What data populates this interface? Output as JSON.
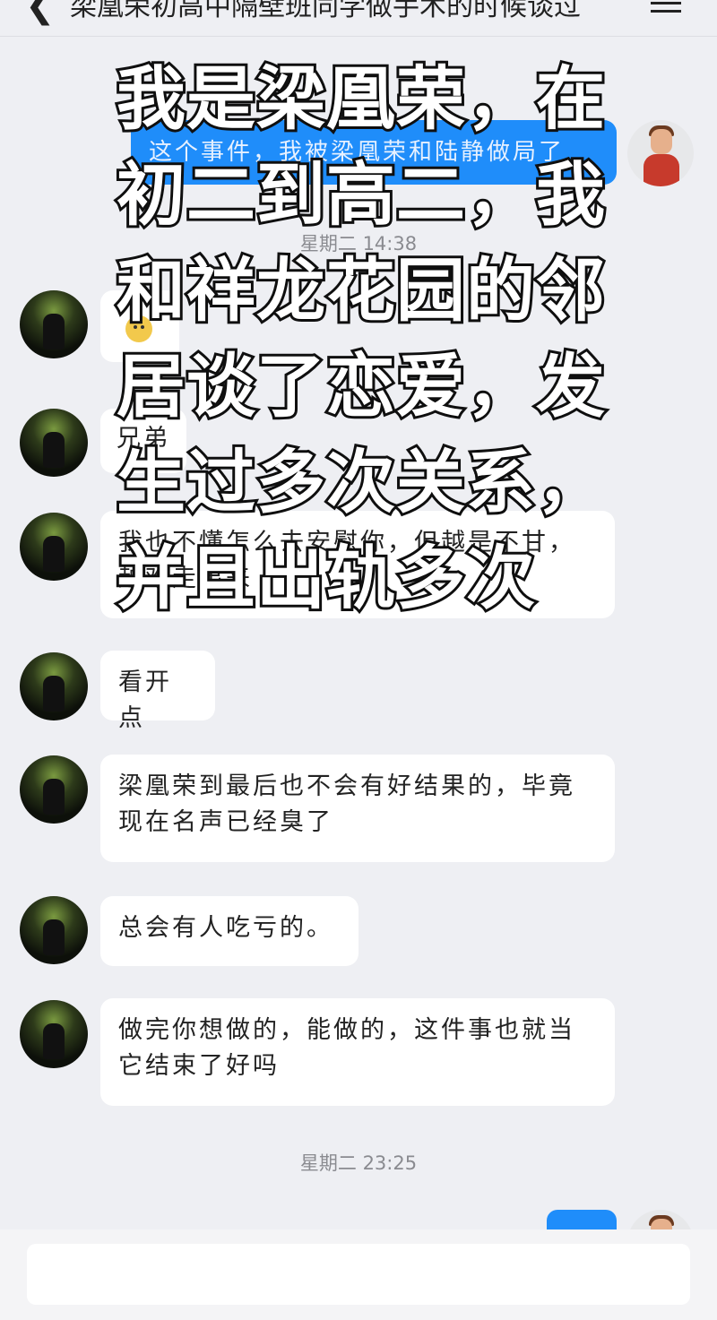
{
  "header": {
    "back_glyph": "❮",
    "title": "梁凰荣初高中隔壁班同学做手术的时候谈过",
    "menu_icon": "menu-icon"
  },
  "messages": {
    "outgoing_top": "这个事件，我被梁凰荣和陆静做局了",
    "time1": "星期二 14:38",
    "msg_brother": "兄弟",
    "msg1": "我也不懂怎么去安慰你，但越是不甘，越难走出来",
    "msg2": "看开点",
    "msg3": "梁凰荣到最后也不会有好结果的，毕竟现在名声已经臭了",
    "msg4": "总会有人吃亏的。",
    "msg5": "做完你想做的，能做的，这件事也就当它结束了好吗",
    "time2": "星期二 23:25"
  },
  "overlay_text": "我是梁凰荣，在初二到高二，我和祥龙花园的邻居谈了恋爱，发生过多次关系，并且出轨多次",
  "input": {
    "placeholder": ""
  },
  "colors": {
    "background": "#eeeff3",
    "outgoing_bubble": "#1f8dfa",
    "incoming_bubble": "#ffffff"
  }
}
